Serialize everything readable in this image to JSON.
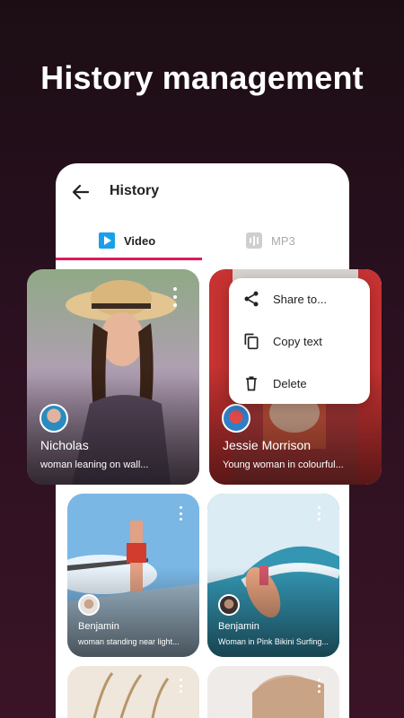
{
  "headline": "History management",
  "appbar": {
    "title": "History"
  },
  "tabs": [
    {
      "label": "Video",
      "icon": "play-icon",
      "active": true
    },
    {
      "label": "MP3",
      "icon": "audio-waveform-icon",
      "active": false
    }
  ],
  "accent": "#e0185e",
  "context_menu": {
    "items": [
      {
        "label": "Share to...",
        "icon": "share-icon"
      },
      {
        "label": "Copy text",
        "icon": "copy-icon"
      },
      {
        "label": "Delete",
        "icon": "trash-icon"
      }
    ]
  },
  "cards": [
    {
      "name": "Nicholas",
      "desc": "woman leaning on wall..."
    },
    {
      "name": "Jessie Morrison",
      "desc": "Young woman in colourful..."
    },
    {
      "name": "Benjamin",
      "desc": "woman standing near light..."
    },
    {
      "name": "Benjamin",
      "desc": "Woman in Pink Bikini Surfing..."
    }
  ]
}
